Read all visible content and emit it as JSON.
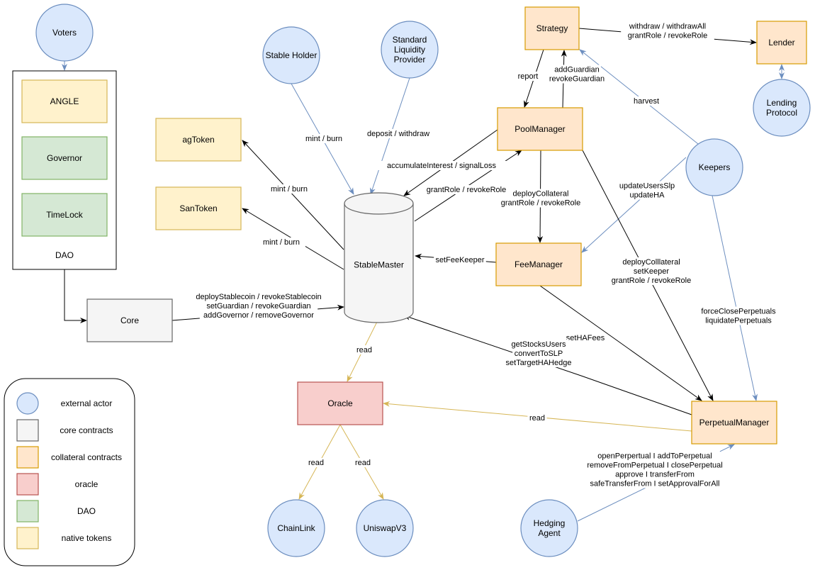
{
  "colors": {
    "actor": {
      "fill": "#dae8fc",
      "stroke": "#6c8ebf"
    },
    "core": {
      "fill": "#f5f5f5",
      "stroke": "#666666"
    },
    "collateral": {
      "fill": "#ffe6cc",
      "stroke": "#d79b00"
    },
    "oracle": {
      "fill": "#f8cecc",
      "stroke": "#b85450"
    },
    "dao": {
      "fill": "#d5e8d4",
      "stroke": "#82b366"
    },
    "native": {
      "fill": "#fff2cc",
      "stroke": "#d6b656"
    },
    "edge_black": "#000000",
    "edge_blue": "#6c8ebf",
    "edge_yellow": "#d6b656"
  },
  "nodes": {
    "voters": {
      "label": [
        "Voters"
      ],
      "kind": "actor"
    },
    "angle": {
      "label": [
        "ANGLE"
      ],
      "kind": "native"
    },
    "governor": {
      "label": [
        "Governor"
      ],
      "kind": "dao"
    },
    "timelock": {
      "label": [
        "TimeLock"
      ],
      "kind": "dao"
    },
    "dao": {
      "label": [
        "DAO"
      ],
      "kind": "group"
    },
    "core": {
      "label": [
        "Core"
      ],
      "kind": "core"
    },
    "stable_holder": {
      "label": [
        "Stable Holder"
      ],
      "kind": "actor"
    },
    "slp": {
      "label": [
        "Standard",
        "Liquidity",
        "Provider"
      ],
      "kind": "actor"
    },
    "agtoken": {
      "label": [
        "agToken"
      ],
      "kind": "native"
    },
    "santoken": {
      "label": [
        "SanToken"
      ],
      "kind": "native"
    },
    "stablemaster": {
      "label": [
        "StableMaster"
      ],
      "kind": "core"
    },
    "strategy": {
      "label": [
        "Strategy"
      ],
      "kind": "collateral"
    },
    "lender": {
      "label": [
        "Lender"
      ],
      "kind": "collateral"
    },
    "lending_protocol": {
      "label": [
        "Lending",
        "Protocol"
      ],
      "kind": "actor"
    },
    "poolmanager": {
      "label": [
        "PoolManager"
      ],
      "kind": "collateral"
    },
    "keepers": {
      "label": [
        "Keepers"
      ],
      "kind": "actor"
    },
    "feemanager": {
      "label": [
        "FeeManager"
      ],
      "kind": "collateral"
    },
    "oracle": {
      "label": [
        "Oracle"
      ],
      "kind": "oracle"
    },
    "chainlink": {
      "label": [
        "ChainLink"
      ],
      "kind": "actor"
    },
    "uniswapv3": {
      "label": [
        "UniswapV3"
      ],
      "kind": "actor"
    },
    "perpetualmanager": {
      "label": [
        "PerpetualManager"
      ],
      "kind": "collateral"
    },
    "hedging_agent": {
      "label": [
        "Hedging",
        "Agent"
      ],
      "kind": "actor"
    }
  },
  "edges": [
    {
      "id": "voters-dao",
      "label": []
    },
    {
      "id": "dao-core",
      "label": []
    },
    {
      "id": "core-stablemaster",
      "label": [
        "deployStablecoin / revokeStablecoin",
        "setGuardian / revokeGuardian",
        "addGovernor / removeGovernor"
      ]
    },
    {
      "id": "holder-stablemaster",
      "label": [
        "mint / burn"
      ]
    },
    {
      "id": "slp-stablemaster",
      "label": [
        "deposit / withdraw"
      ]
    },
    {
      "id": "stablemaster-agtoken",
      "label": [
        "mint / burn"
      ]
    },
    {
      "id": "stablemaster-santoken",
      "label": [
        "mint / burn"
      ]
    },
    {
      "id": "poolmanager-stablemaster",
      "label": [
        "accumulateInterest / signalLoss"
      ]
    },
    {
      "id": "stablemaster-poolmanager",
      "label": [
        "grantRole / revokeRole"
      ]
    },
    {
      "id": "strategy-poolmanager",
      "label": [
        "report"
      ]
    },
    {
      "id": "poolmanager-strategy",
      "label": [
        "addGuardian",
        "revokeGuardian"
      ]
    },
    {
      "id": "strategy-lender",
      "label": [
        "withdraw / withdrawAll",
        "grantRole / revokeRole"
      ]
    },
    {
      "id": "lender-lendingprotocol",
      "label": []
    },
    {
      "id": "keepers-strategy",
      "label": [
        "harvest"
      ]
    },
    {
      "id": "keepers-feemanager",
      "label": [
        "updateUsersSlp",
        "updateHA"
      ]
    },
    {
      "id": "keepers-perpetualmanager",
      "label": [
        "forceClosePerpetuals",
        "liquidatePerpetuals"
      ]
    },
    {
      "id": "poolmanager-feemanager",
      "label": [
        "deployCollateral",
        "grantRole / revokeRole"
      ]
    },
    {
      "id": "poolmanager-perpetualmanager",
      "label": [
        "deployColllateral",
        "setKeeper",
        "grantRole / revokeRole"
      ]
    },
    {
      "id": "feemanager-stablemaster",
      "label": [
        "setFeeKeeper"
      ]
    },
    {
      "id": "feemanager-perpetualmanager",
      "label": [
        "setHAFees"
      ]
    },
    {
      "id": "perpetualmanager-stablemaster",
      "label": [
        "getStocksUsers",
        "convertToSLP",
        "setTargetHAHedge"
      ]
    },
    {
      "id": "perpetualmanager-oracle",
      "label": [
        "read"
      ]
    },
    {
      "id": "stablemaster-oracle",
      "label": [
        "read"
      ]
    },
    {
      "id": "oracle-chainlink",
      "label": [
        "read"
      ]
    },
    {
      "id": "oracle-uniswapv3",
      "label": [
        "read"
      ]
    },
    {
      "id": "hedgingagent-perpetualmanager",
      "label": [
        "openPerpertual I addToPerpetual",
        "removeFromPerpetual I closePerpetual",
        "approve I transferFrom",
        "safeTransferFrom I setApprovalForAll"
      ]
    }
  ],
  "legend": {
    "items": [
      {
        "kind": "actor",
        "label": "external actor"
      },
      {
        "kind": "core",
        "label": "core contracts"
      },
      {
        "kind": "collateral",
        "label": "collateral contracts"
      },
      {
        "kind": "oracle",
        "label": "oracle"
      },
      {
        "kind": "dao",
        "label": "DAO"
      },
      {
        "kind": "native",
        "label": "native tokens"
      }
    ]
  }
}
